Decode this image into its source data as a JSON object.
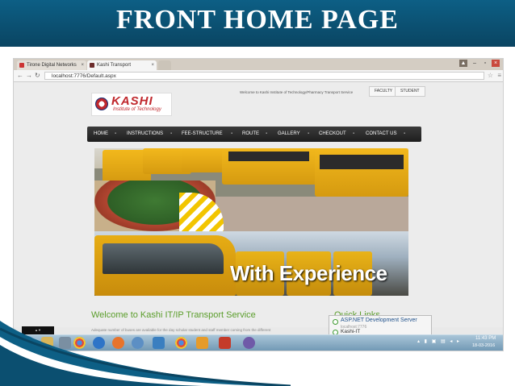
{
  "slide": {
    "title": "FRONT HOME PAGE"
  },
  "browser": {
    "tabs": [
      {
        "label": "Tirone Digital Networks",
        "active": false
      },
      {
        "label": "Kashi Transport",
        "active": true
      }
    ],
    "url": "localhost:7776/Default.aspx"
  },
  "site": {
    "logo_name": "KASHI",
    "logo_sub": "Institute of Technology",
    "welcome_top": "Welcome to Kashi Institute of Technology/Pharmacy Transport Service",
    "top_buttons": [
      "FACULTY",
      "STUDENT"
    ],
    "nav": [
      "HOME",
      "INSTRUCTIONS",
      "FEE-STRUCTURE",
      "ROUTE",
      "GALLERY",
      "CHECKOUT",
      "CONTACT US"
    ],
    "hero_tagline": "With Experience",
    "welcome_heading": "Welcome to Kashi IT/IP Transport Service",
    "welcome_text": "Adequate number of buses are available for the day scholar student and staff member coming from the different",
    "quick_links_heading": "Quick Links"
  },
  "notification": {
    "title": "ASP.NET Development Server",
    "subtitle": "localhost:7776",
    "item": "Kashi-IT"
  },
  "taskbar": {
    "time": "11:43 PM",
    "date": "18-03-2016"
  },
  "colors": {
    "banner": "#0b4f70",
    "brand_red": "#c0282d",
    "heading_green": "#5a9d2a",
    "nav_bg": "#262626"
  }
}
